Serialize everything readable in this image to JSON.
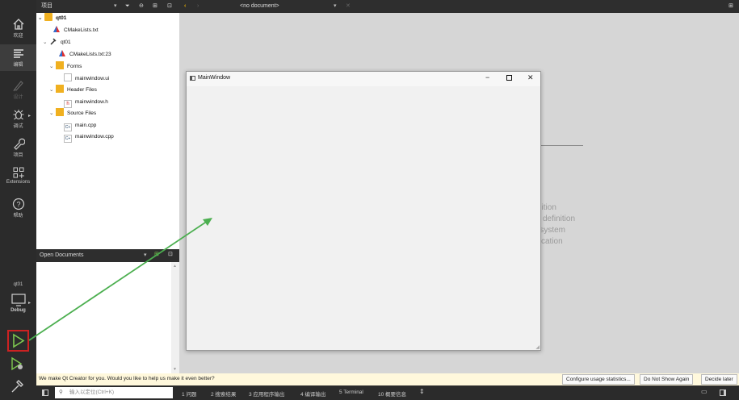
{
  "modes": [
    {
      "label": "欢迎",
      "icon": "home-icon"
    },
    {
      "label": "编辑",
      "icon": "edit-icon"
    },
    {
      "label": "设计",
      "icon": "design-icon"
    },
    {
      "label": "调试",
      "icon": "debug-icon"
    },
    {
      "label": "项目",
      "icon": "wrench-icon"
    },
    {
      "label": "Extensions",
      "icon": "extensions-icon"
    },
    {
      "label": "帮助",
      "icon": "help-icon"
    }
  ],
  "kit": {
    "project": "qt01",
    "build": "Debug"
  },
  "toolbar": {
    "projects_label": "项目",
    "document": "<no document>"
  },
  "tree": [
    {
      "label": "qt01",
      "icon": "project-folder-icon"
    },
    {
      "label": "CMakeLists.txt",
      "icon": "cmake-icon"
    },
    {
      "label": "qt01",
      "icon": "build-target-icon"
    },
    {
      "label": "CMakeLists.txt:23",
      "icon": "cmake-icon"
    },
    {
      "label": "Forms",
      "icon": "forms-folder-icon"
    },
    {
      "label": "mainwindow.ui",
      "icon": "ui-file-icon"
    },
    {
      "label": "Header Files",
      "icon": "header-folder-icon"
    },
    {
      "label": "mainwindow.h",
      "icon": "header-file-icon"
    },
    {
      "label": "Source Files",
      "icon": "source-folder-icon"
    },
    {
      "label": "main.cpp",
      "icon": "cpp-file-icon"
    },
    {
      "label": "mainwindow.cpp",
      "icon": "cpp-file-icon"
    }
  ],
  "open_documents": {
    "title": "Open Documents"
  },
  "welcome_fragments": [
    "finition",
    "definition",
    "e system",
    "cation"
  ],
  "app_window": {
    "title": "MainWindow"
  },
  "infobar": {
    "message": "We make Qt Creator for you. Would you like to help us make it even better?",
    "buttons": [
      "Configure usage statistics...",
      "Do Not Show Again",
      "Decide later"
    ]
  },
  "statusbar": {
    "locator_placeholder": "输入以定位(Ctrl+K)",
    "panes": [
      "1 问题",
      "2 搜索结果",
      "3 应用程序输出",
      "4 编译输出",
      "5 Terminal",
      "10 概要信息"
    ]
  },
  "colors": {
    "accent_green": "#4caf50",
    "highlight_red": "#cc2222",
    "infobar_bg": "#fff8dc"
  }
}
